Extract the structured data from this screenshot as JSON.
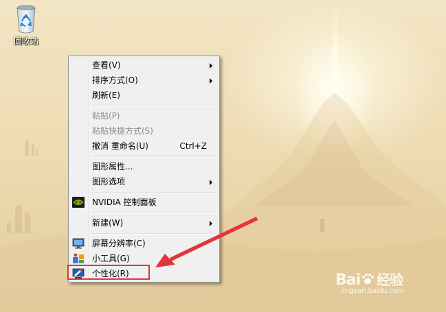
{
  "desktop": {
    "recycle_bin_label": "回收站"
  },
  "context_menu": {
    "items": [
      {
        "label": "查看(V)",
        "submenu": true
      },
      {
        "label": "排序方式(O)",
        "submenu": true
      },
      {
        "label": "刷新(E)"
      },
      {
        "label": "粘贴(P)",
        "disabled": true
      },
      {
        "label": "粘贴快捷方式(S)",
        "disabled": true
      },
      {
        "label": "撤消 重命名(U)",
        "shortcut": "Ctrl+Z"
      },
      {
        "label": "图形属性..."
      },
      {
        "label": "图形选项",
        "submenu": true
      },
      {
        "label": "NVIDIA 控制面板",
        "icon": "nvidia-icon"
      },
      {
        "label": "新建(W)",
        "submenu": true
      },
      {
        "label": "屏幕分辨率(C)",
        "icon": "monitor-icon"
      },
      {
        "label": "小工具(G)",
        "icon": "gadgets-icon"
      },
      {
        "label": "个性化(R)",
        "icon": "personalize-icon",
        "highlighted": true
      }
    ]
  },
  "annotation": {
    "color": "#e0353a"
  },
  "watermark": {
    "brand": "Bai",
    "brand_suffix": "经验",
    "url": "jingyan.baidu.com"
  }
}
